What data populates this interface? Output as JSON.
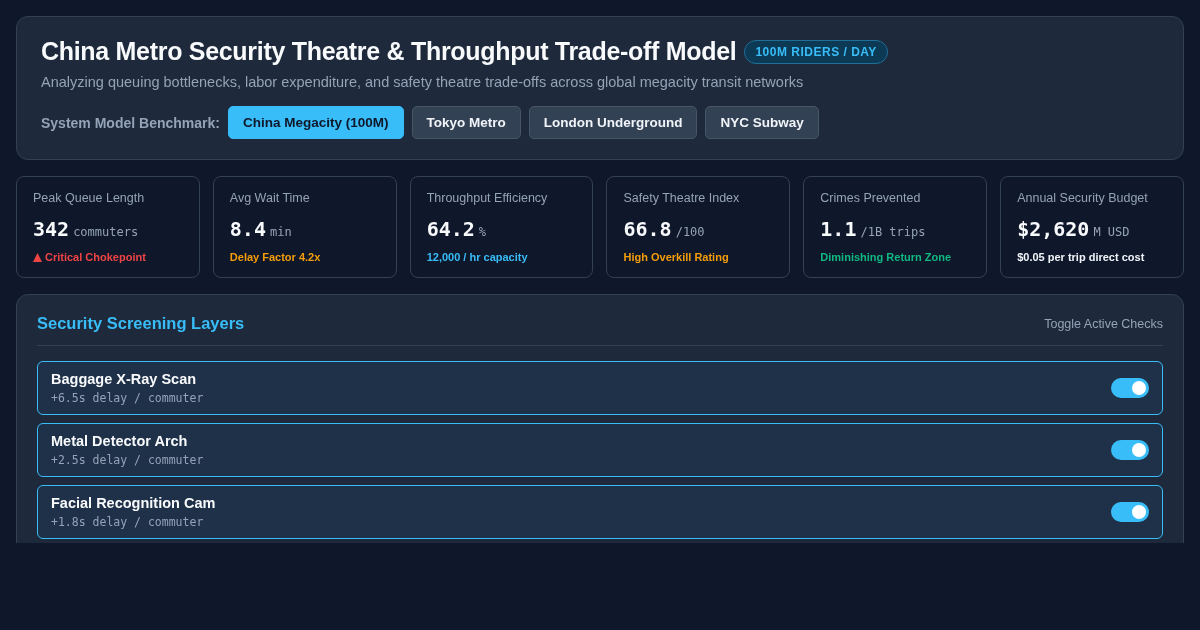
{
  "header": {
    "title": "China Metro Security Theatre & Throughput Trade-off Model",
    "badge": "100M RIDERS / DAY",
    "subtitle": "Analyzing queuing bottlenecks, labor expenditure, and safety theatre trade-offs across global megacity transit networks",
    "benchmark_label": "System Model Benchmark:",
    "benchmarks": [
      {
        "label": "China Megacity (100M)",
        "selected": true
      },
      {
        "label": "Tokyo Metro",
        "selected": false
      },
      {
        "label": "London Underground",
        "selected": false
      },
      {
        "label": "NYC Subway",
        "selected": false
      }
    ]
  },
  "stats": [
    {
      "label": "Peak Queue Length",
      "value": "342",
      "unit": "commuters",
      "note": "Critical Chokepoint",
      "alert": true,
      "color": "#ef4444"
    },
    {
      "label": "Avg Wait Time",
      "value": "8.4",
      "unit": "min",
      "note": "Delay Factor 4.2x",
      "alert": false,
      "color": "#f59e0b"
    },
    {
      "label": "Throughput Efficiency",
      "value": "64.2",
      "unit": "%",
      "note": "12,000 / hr capacity",
      "alert": false,
      "color": "#38bdf8"
    },
    {
      "label": "Safety Theatre Index",
      "value": "66.8",
      "unit": "/100",
      "note": "High Overkill Rating",
      "alert": false,
      "color": "#f59e0b"
    },
    {
      "label": "Crimes Prevented",
      "value": "1.1",
      "unit": "/1B trips",
      "note": "Diminishing Return Zone",
      "alert": false,
      "color": "#10b981"
    },
    {
      "label": "Annual Security Budget",
      "value": "$2,620",
      "unit": "M USD",
      "note": "$0.05 per trip direct cost",
      "alert": false,
      "color": "#f1f5f9"
    }
  ],
  "layers_panel": {
    "title": "Security Screening Layers",
    "hint": "Toggle Active Checks",
    "layers": [
      {
        "name": "Baggage X-Ray Scan",
        "delay": "+6.5s delay / commuter",
        "on": true
      },
      {
        "name": "Metal Detector Arch",
        "delay": "+2.5s delay / commuter",
        "on": true
      },
      {
        "name": "Facial Recognition Cam",
        "delay": "+1.8s delay / commuter",
        "on": true
      }
    ]
  }
}
